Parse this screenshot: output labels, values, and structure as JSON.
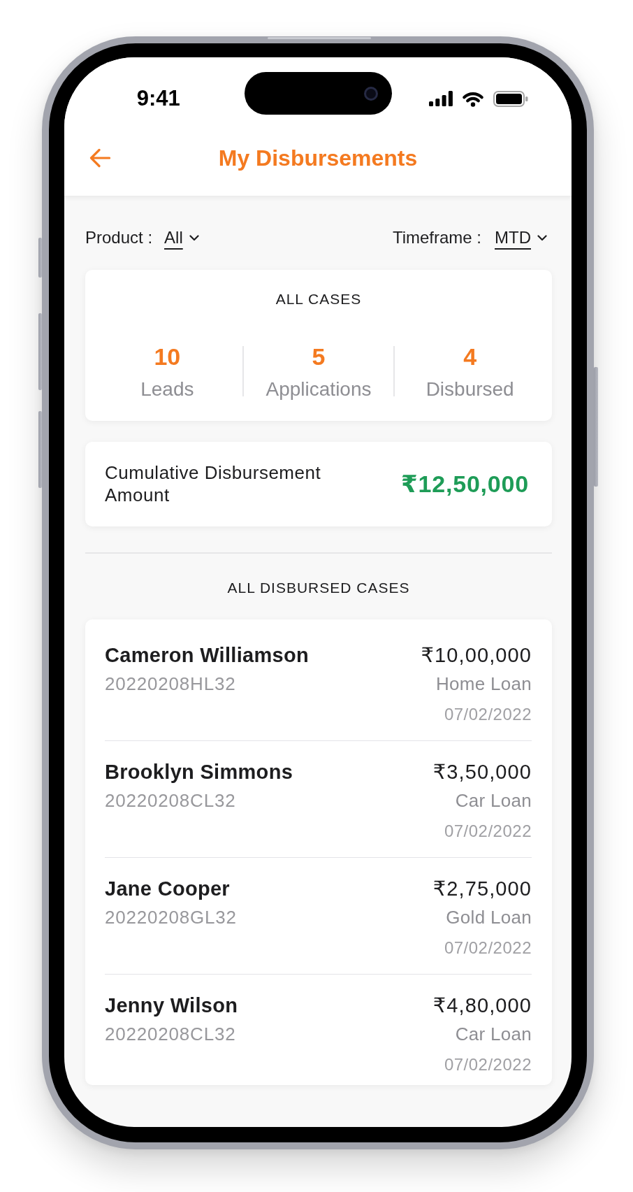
{
  "status_bar": {
    "time": "9:41"
  },
  "header": {
    "title": "My Disbursements"
  },
  "filters": [
    {
      "label": "Product :",
      "value": "All"
    },
    {
      "label": "Timeframe :",
      "value": "MTD"
    }
  ],
  "summary": {
    "title": "ALL CASES",
    "stats": [
      {
        "value": "10",
        "label": "Leads"
      },
      {
        "value": "5",
        "label": "Applications"
      },
      {
        "value": "4",
        "label": "Disbursed"
      }
    ]
  },
  "cumulative": {
    "label": "Cumulative Disbursement Amount",
    "amount": "₹12,50,000"
  },
  "cases": {
    "title": "ALL DISBURSED CASES",
    "items": [
      {
        "name": "Cameron Williamson",
        "id": "20220208HL32",
        "amount": "₹10,00,000",
        "product": "Home Loan",
        "date": "07/02/2022"
      },
      {
        "name": "Brooklyn Simmons",
        "id": "20220208CL32",
        "amount": "₹3,50,000",
        "product": "Car Loan",
        "date": "07/02/2022"
      },
      {
        "name": "Jane Cooper",
        "id": "20220208GL32",
        "amount": "₹2,75,000",
        "product": "Gold Loan",
        "date": "07/02/2022"
      },
      {
        "name": "Jenny Wilson",
        "id": "20220208CL32",
        "amount": "₹4,80,000",
        "product": "Car Loan",
        "date": "07/02/2022"
      }
    ]
  }
}
